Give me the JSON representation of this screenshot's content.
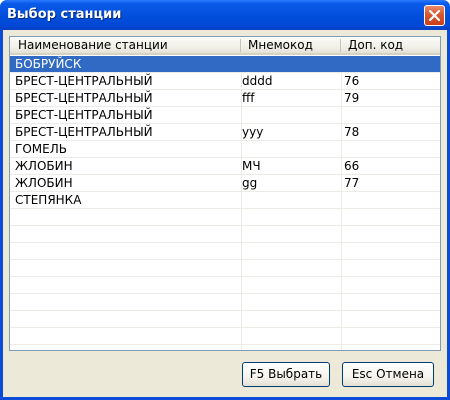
{
  "window": {
    "title": "Выбор станции"
  },
  "columns": [
    "Наименование станции",
    "Мнемокод",
    "Доп. код"
  ],
  "rows": [
    {
      "name": "БОБРУЙСК",
      "mnemo": "",
      "code": "",
      "selected": true
    },
    {
      "name": "БРЕСТ-ЦЕНТРАЛЬНЫЙ",
      "mnemo": "dddd",
      "code": "76"
    },
    {
      "name": "БРЕСТ-ЦЕНТРАЛЬНЫЙ",
      "mnemo": "fff",
      "code": "79"
    },
    {
      "name": "БРЕСТ-ЦЕНТРАЛЬНЫЙ",
      "mnemo": "",
      "code": ""
    },
    {
      "name": "БРЕСТ-ЦЕНТРАЛЬНЫЙ",
      "mnemo": "yyy",
      "code": "78"
    },
    {
      "name": "ГОМЕЛЬ",
      "mnemo": "",
      "code": ""
    },
    {
      "name": "ЖЛОБИН",
      "mnemo": "МЧ",
      "code": "66"
    },
    {
      "name": "ЖЛОБИН",
      "mnemo": "gg",
      "code": "77"
    },
    {
      "name": "СТЕПЯНКА",
      "mnemo": "",
      "code": ""
    }
  ],
  "buttons": {
    "select": "F5 Выбрать",
    "cancel": "Esc Отмена"
  },
  "colors": {
    "selection": "#316ac5",
    "titlebar": "#0350dd"
  }
}
